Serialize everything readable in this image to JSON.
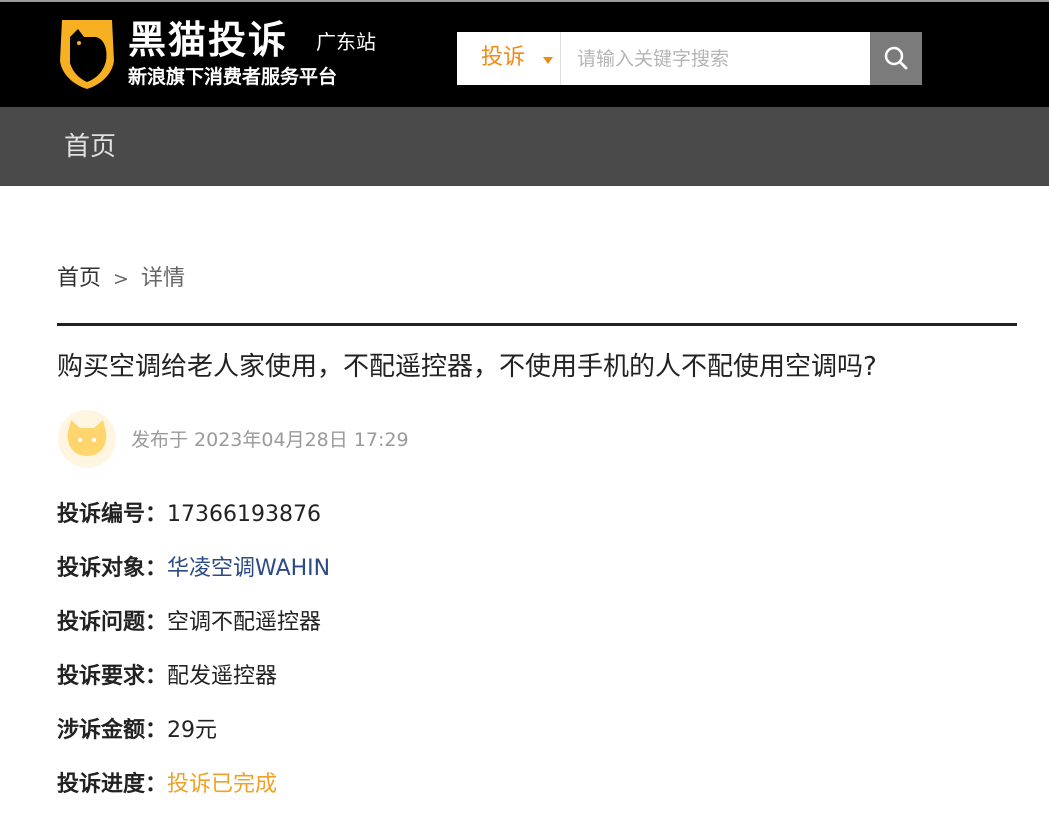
{
  "header": {
    "logo_title": "黑猫投诉",
    "station": "广东站",
    "slogan": "新浪旗下消费者服务平台"
  },
  "search": {
    "type_label": "投诉",
    "placeholder": "请输入关键字搜索",
    "value": ""
  },
  "nav": {
    "home": "首页"
  },
  "breadcrumb": {
    "home": "首页",
    "separator": ">",
    "current": "详情"
  },
  "complaint": {
    "title": "购买空调给老人家使用，不配遥控器，不使用手机的人不配使用空调吗?",
    "published": "发布于 2023年04月28日 17:29",
    "fields": [
      {
        "label": "投诉编号：",
        "value": "17366193876"
      },
      {
        "label": "投诉对象：",
        "value": "华凌空调WAHIN"
      },
      {
        "label": "投诉问题：",
        "value": "空调不配遥控器"
      },
      {
        "label": "投诉要求：",
        "value": "配发遥控器"
      },
      {
        "label": "涉诉金额：",
        "value": "29元"
      },
      {
        "label": "投诉进度：",
        "value": "投诉已完成"
      }
    ]
  },
  "colors": {
    "header_bg": "#000000",
    "nav_bg": "#4a4a4a",
    "accent_orange": "#f08a16",
    "logo_yellow": "#f6b021",
    "link_blue": "#2c4a86",
    "status_orange": "#f0a024"
  },
  "icons": {
    "logo": "black-cat-shield-icon",
    "search": "search-icon",
    "dropdown": "caret-down-icon",
    "avatar": "cat-avatar-icon"
  }
}
